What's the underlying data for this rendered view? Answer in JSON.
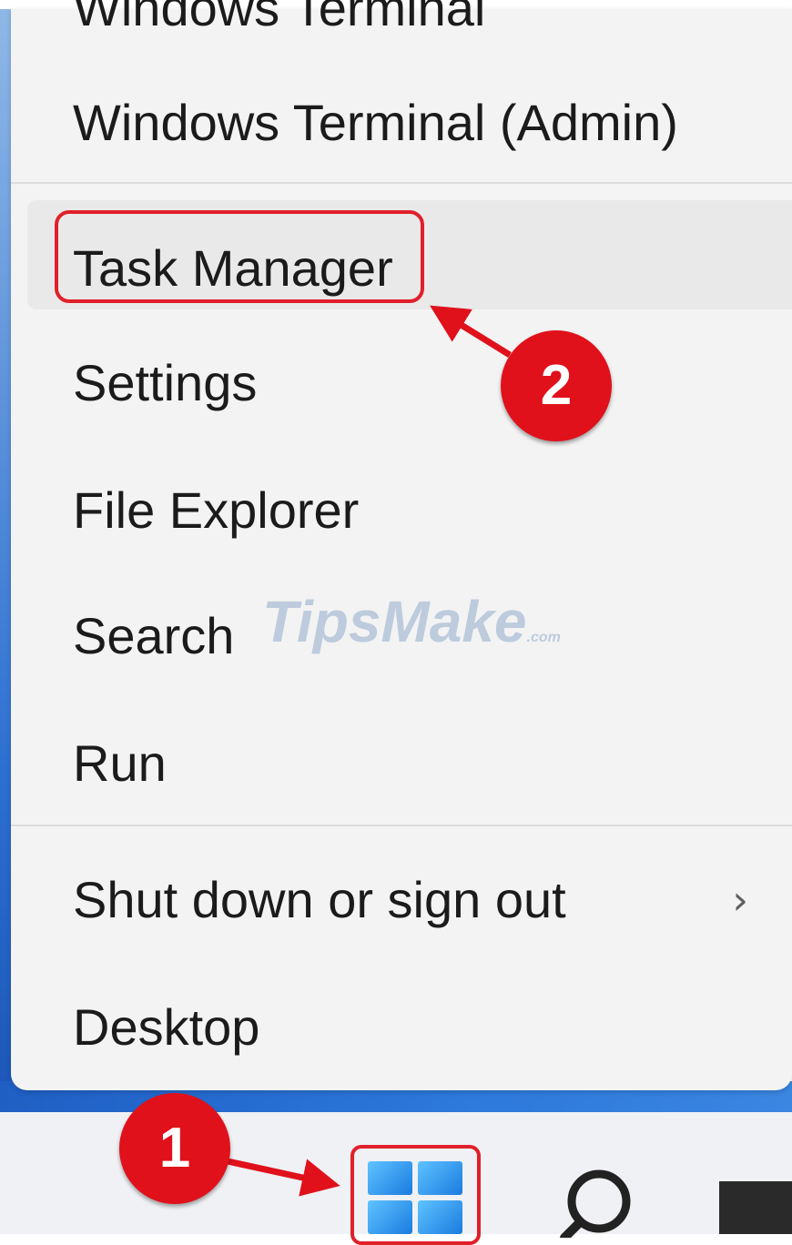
{
  "menu": {
    "items": [
      {
        "label": "Windows Terminal"
      },
      {
        "label": "Windows Terminal (Admin)"
      },
      {
        "label": "Task Manager"
      },
      {
        "label": "Settings"
      },
      {
        "label": "File Explorer"
      },
      {
        "label": "Search"
      },
      {
        "label": "Run"
      },
      {
        "label": "Shut down or sign out"
      },
      {
        "label": "Desktop"
      }
    ],
    "submenu_indicator": "›"
  },
  "annotations": {
    "step1": "1",
    "step2": "2",
    "color": "#e0111b"
  },
  "watermark": {
    "text": "TipsMake",
    "suffix": ".com"
  },
  "taskbar": {
    "icons": [
      "windows-start-icon",
      "search-icon",
      "app-icon"
    ],
    "accent": "#1b7be0"
  }
}
